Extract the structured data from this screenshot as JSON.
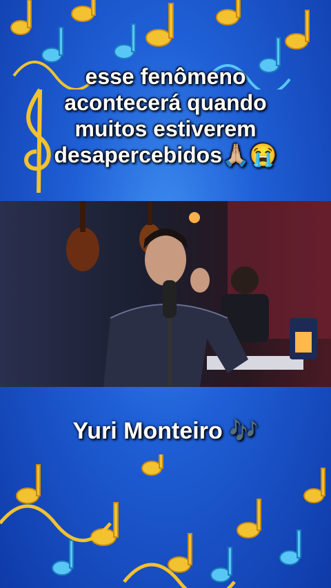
{
  "caption": {
    "text": "esse fenômeno acontecerá quando muitos estiverem desapercebidos🙏🏼😭"
  },
  "video": {
    "description_icon": "singer-performing-icon"
  },
  "artist": {
    "name": "Yuri Monteiro 🎶"
  },
  "colors": {
    "background": "#1a55c8",
    "note_gold": "#f2c230",
    "note_blue": "#58c7f5"
  }
}
